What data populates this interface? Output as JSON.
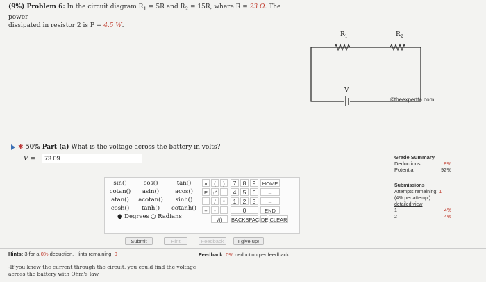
{
  "problem": {
    "header": "(9%) Problem 6:",
    "text1": "In the circuit diagram R",
    "r1_sub": "1",
    "eq1": " = 5R and R",
    "r2_sub": "2",
    "eq2": " = 15R, where R = ",
    "r_value": "23 Ω",
    "text2": ". The power",
    "line2a": "dissipated in resistor 2 is P = ",
    "p_value": "4.5 W",
    "line2b": "."
  },
  "circuit": {
    "r1_label": "R",
    "r1_sub": "1",
    "r2_label": "R",
    "r2_sub": "2",
    "v_label": "V",
    "copyright": "©theexpertta.com"
  },
  "part": {
    "label": "50% Part (a)",
    "question": "What is the voltage across the battery in volts?",
    "answer_label": "V =",
    "answer_value": "73.09"
  },
  "calculator": {
    "functions": [
      [
        "sin()",
        "cos()",
        "tan()"
      ],
      [
        "cotan()",
        "asin()",
        "acos()"
      ],
      [
        "atan()",
        "acotan()",
        "sinh()"
      ],
      [
        "cosh()",
        "tanh()",
        "cotanh()"
      ]
    ],
    "degrees": "Degrees",
    "radians": "Radians",
    "keys_col1": [
      "π",
      "E",
      "",
      "+",
      ""
    ],
    "keys_col2": [
      "(",
      "↑^",
      "/",
      "-",
      "√()"
    ],
    "keys_col3": [
      ")",
      "",
      "*",
      "",
      ""
    ],
    "digits": [
      [
        "7",
        "8",
        "9"
      ],
      [
        "4",
        "5",
        "6"
      ],
      [
        "1",
        "2",
        "3"
      ],
      [
        "",
        "0",
        ""
      ]
    ],
    "home": "HOME",
    "back_arrow": "←",
    "fwd_arrow": "→",
    "end": "END",
    "backspace": "BACKSPACE",
    "del": "DEL",
    "clear": "CLEAR"
  },
  "buttons": {
    "submit": "Submit",
    "hint": "Hint",
    "feedback": "Feedback",
    "give_up": "I give up!"
  },
  "hints": {
    "label": "Hints:",
    "count_text": "3 for a",
    "percent": "0%",
    "deduction_text": "deduction. Hints remaining:",
    "remaining": "0",
    "hint_text": "-If you knew the current through the circuit, you could find the voltage across the battery with Ohm's law."
  },
  "feedback": {
    "label": "Feedback:",
    "percent": "0%",
    "text": "deduction per feedback."
  },
  "grade": {
    "title": "Grade Summary",
    "deductions_label": "Deductions",
    "deductions_value": "8%",
    "potential_label": "Potential",
    "potential_value": "92%"
  },
  "submissions": {
    "title": "Submissions",
    "attempts_text": "Attempts remaining:",
    "attempts_value": "1",
    "per_attempt": "(4% per attempt)",
    "detailed": "detailed view",
    "rows": [
      [
        "1",
        "4%"
      ],
      [
        "2",
        "4%"
      ]
    ]
  },
  "colors": {
    "accent": "#3a6fb5",
    "red": "#c0392b"
  }
}
